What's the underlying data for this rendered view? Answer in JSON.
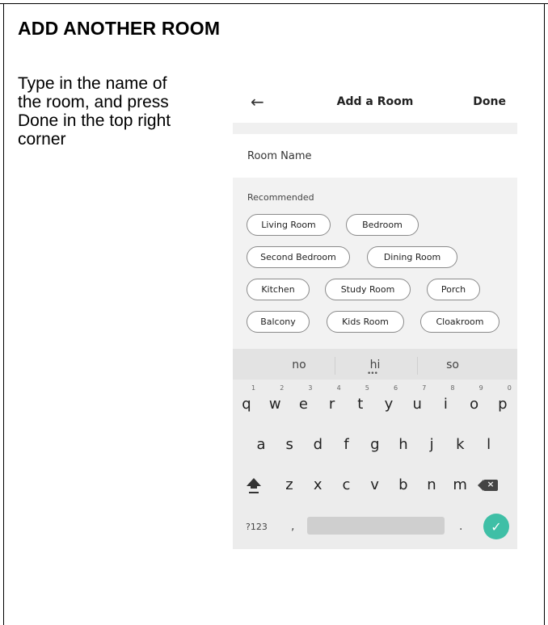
{
  "document": {
    "heading": "ADD ANOTHER ROOM",
    "instructions": "Type in the name of the room, and press Done in the top right corner"
  },
  "app": {
    "title": "Add a Room",
    "done_label": "Done",
    "back_icon": "arrow-left-icon",
    "room_name_placeholder": "Room Name",
    "recommended_label": "Recommended",
    "chips": [
      "Living Room",
      "Bedroom",
      "Second Bedroom",
      "Dining Room",
      "Kitchen",
      "Study Room",
      "Porch",
      "Balcony",
      "Kids Room",
      "Cloakroom"
    ]
  },
  "keyboard": {
    "suggestions": [
      "no",
      "hi",
      "so"
    ],
    "row1": [
      "q",
      "w",
      "e",
      "r",
      "t",
      "y",
      "u",
      "i",
      "o",
      "p"
    ],
    "row1_numbers": [
      "1",
      "2",
      "3",
      "4",
      "5",
      "6",
      "7",
      "8",
      "9",
      "0"
    ],
    "row2": [
      "a",
      "s",
      "d",
      "f",
      "g",
      "h",
      "j",
      "k",
      "l"
    ],
    "row3": [
      "z",
      "x",
      "c",
      "v",
      "b",
      "n",
      "m"
    ],
    "symbols_label": "?123",
    "comma": ",",
    "period": ".",
    "enter_icon": "check-icon",
    "accent_color": "#3fbfa6"
  }
}
